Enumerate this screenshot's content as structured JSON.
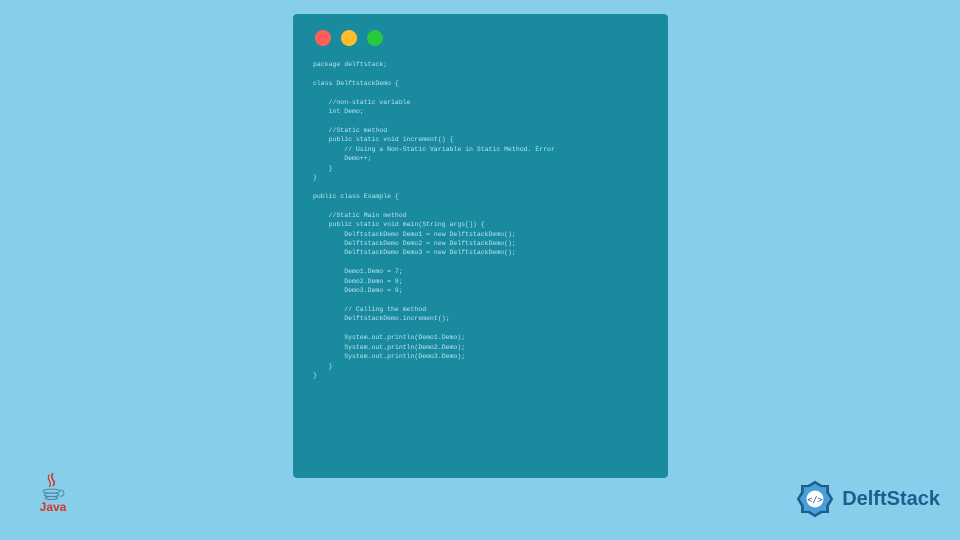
{
  "code": {
    "lines": [
      "package delftstack;",
      "",
      "class DelftstackDemo {",
      "",
      "    //non-static variable",
      "    int Demo;",
      "",
      "    //Static method",
      "    public static void increment() {",
      "        // Using a Non-Static Variable in Static Method. Error",
      "        Demo++;",
      "    }",
      "}",
      "",
      "public class Example {",
      "",
      "    //Static Main method",
      "    public static void main(String args[]) {",
      "        DelftstackDemo Demo1 = new DelftstackDemo();",
      "        DelftstackDemo Demo2 = new DelftstackDemo();",
      "        DelftstackDemo Demo3 = new DelftstackDemo();",
      "",
      "        Demo1.Demo = 7;",
      "        Demo2.Demo = 8;",
      "        Demo3.Demo = 9;",
      "",
      "        // Calling the method",
      "        DelftstackDemo.increment();",
      "",
      "        System.out.println(Demo1.Demo);",
      "        System.out.println(Demo2.Demo);",
      "        System.out.println(Demo3.Demo);",
      "    }",
      "}"
    ]
  },
  "logos": {
    "java_label": "Java",
    "delft_label": "DelftStack"
  }
}
